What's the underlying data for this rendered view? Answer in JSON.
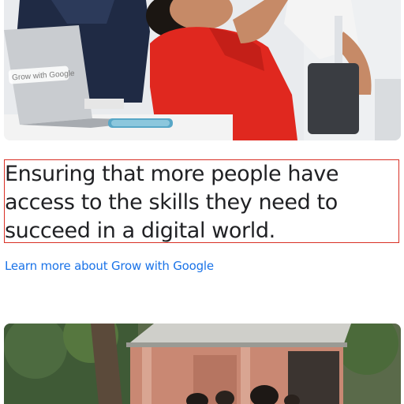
{
  "story": {
    "headline": "Ensuring that more people have access to the skills they need to succeed in a digital world.",
    "link_text": "Learn more about Grow with Google",
    "laptop_sticker": "Grow with Google",
    "link_color": "#1a73e8"
  }
}
